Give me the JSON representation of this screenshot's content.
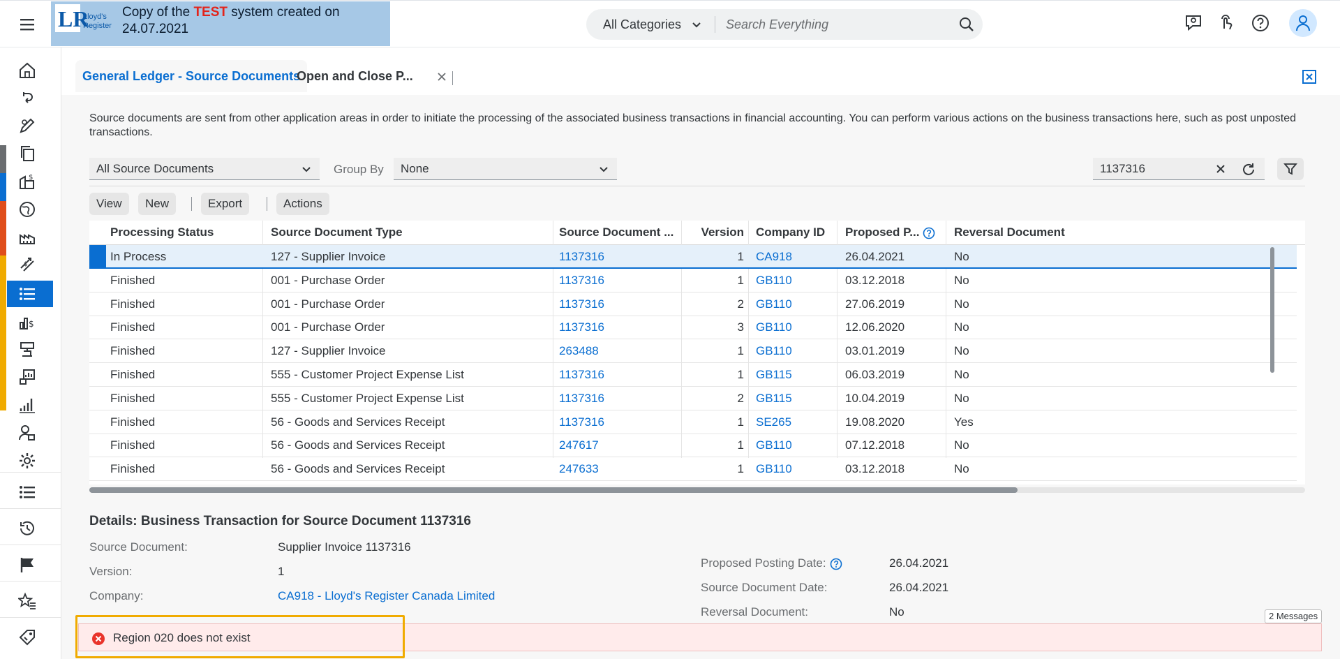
{
  "shell": {
    "banner": {
      "line1_prefix": "Copy of the ",
      "line1_highlight": "TEST",
      "line1_suffix": " system created on",
      "line2": "24.07.2021",
      "logo_text_1": "Lloyd's",
      "logo_text_2": "Register"
    },
    "search": {
      "category": "All Categories",
      "placeholder": "Search Everything"
    }
  },
  "tabs": [
    {
      "label": "General Ledger - Source Documents"
    },
    {
      "label": "Open and Close P..."
    }
  ],
  "page": {
    "description": "Source documents are sent from other application areas in order to initiate the processing of the associated business transactions in financial accounting. You can perform various actions on the business transactions here, such as post unposted transactions.",
    "source_select": "All Source Documents",
    "group_by_label": "Group By",
    "group_by_value": "None",
    "filter_value": "1137316"
  },
  "toolbar": {
    "view": "View",
    "new": "New",
    "export": "Export",
    "actions": "Actions"
  },
  "table": {
    "headers": [
      "Processing Status",
      "Source Document Type",
      "Source Document ...",
      "Version",
      "Company ID",
      "Proposed P...",
      "Reversal Document"
    ],
    "rows": [
      {
        "status": "In Process",
        "type": "127 - Supplier Invoice",
        "doc": "1137316",
        "version": "1",
        "company": "CA918",
        "date": "26.04.2021",
        "reversal": "No"
      },
      {
        "status": "Finished",
        "type": "001 - Purchase Order",
        "doc": "1137316",
        "version": "1",
        "company": "GB110",
        "date": "03.12.2018",
        "reversal": "No"
      },
      {
        "status": "Finished",
        "type": "001 - Purchase Order",
        "doc": "1137316",
        "version": "2",
        "company": "GB110",
        "date": "27.06.2019",
        "reversal": "No"
      },
      {
        "status": "Finished",
        "type": "001 - Purchase Order",
        "doc": "1137316",
        "version": "3",
        "company": "GB110",
        "date": "12.06.2020",
        "reversal": "No"
      },
      {
        "status": "Finished",
        "type": "127 - Supplier Invoice",
        "doc": "263488",
        "version": "1",
        "company": "GB110",
        "date": "03.01.2019",
        "reversal": "No"
      },
      {
        "status": "Finished",
        "type": "555 - Customer Project Expense List",
        "doc": "1137316",
        "version": "1",
        "company": "GB115",
        "date": "06.03.2019",
        "reversal": "No"
      },
      {
        "status": "Finished",
        "type": "555 - Customer Project Expense List",
        "doc": "1137316",
        "version": "2",
        "company": "GB115",
        "date": "10.04.2019",
        "reversal": "No"
      },
      {
        "status": "Finished",
        "type": "56 - Goods and Services Receipt",
        "doc": "1137316",
        "version": "1",
        "company": "SE265",
        "date": "19.08.2020",
        "reversal": "Yes"
      },
      {
        "status": "Finished",
        "type": "56 - Goods and Services Receipt",
        "doc": "247617",
        "version": "1",
        "company": "GB110",
        "date": "07.12.2018",
        "reversal": "No"
      },
      {
        "status": "Finished",
        "type": "56 - Goods and Services Receipt",
        "doc": "247633",
        "version": "1",
        "company": "GB110",
        "date": "03.12.2018",
        "reversal": "No"
      }
    ]
  },
  "details": {
    "title": "Details: Business Transaction for Source Document 1137316",
    "source_document_label": "Source Document:",
    "source_document_value": "Supplier Invoice 1137316",
    "version_label": "Version:",
    "version_value": "1",
    "company_label": "Company:",
    "company_value": "CA918 - Lloyd's Register Canada Limited",
    "posting_date_label": "Proposed Posting Date:",
    "posting_date_value": "26.04.2021",
    "source_date_label": "Source Document Date:",
    "source_date_value": "26.04.2021",
    "reversal_label": "Reversal Document:",
    "reversal_value": "No"
  },
  "messages": {
    "error_text": "Region 020 does not exist",
    "count_label": "2 Messages"
  },
  "colors": {
    "accent": "#0a6ed1",
    "banner_bg": "#a6c8e6",
    "error": "#e9342b",
    "highlight_frame": "#f0ab00"
  },
  "sidebar_icons": [
    "home-icon",
    "refresh-icon",
    "edit-icon",
    "copy-icon",
    "billing-icon",
    "globe-icon",
    "factory-icon",
    "exchange-icon",
    "list-icon",
    "money-icon",
    "cost-icon",
    "chart-icon",
    "bar-chart-icon",
    "user-lock-icon",
    "settings-icon",
    "list-icon",
    "history-icon",
    "flag-icon",
    "favorites-icon",
    "tag-icon"
  ]
}
